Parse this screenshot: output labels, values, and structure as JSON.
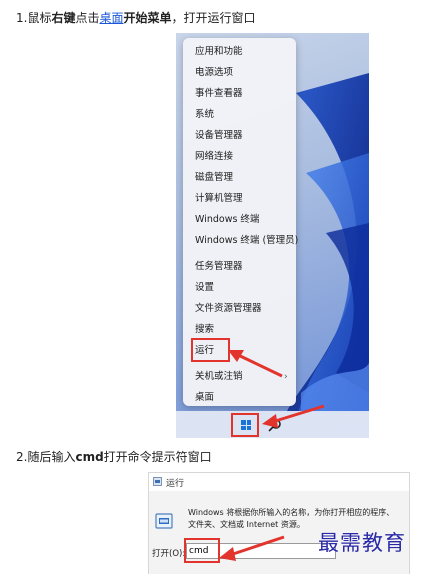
{
  "steps": {
    "step1": {
      "prefix": "1.鼠标",
      "bold1": "右键",
      "mid": "点击",
      "link": "桌面",
      "bold2": "开始菜单",
      "suffix": "，打开运行窗口"
    },
    "step2": {
      "prefix": "2.随后输入",
      "bold": "cmd",
      "suffix": "打开命令提示符窗口"
    }
  },
  "context_menu": {
    "items": [
      "应用和功能",
      "电源选项",
      "事件查看器",
      "系统",
      "设备管理器",
      "网络连接",
      "磁盘管理",
      "计算机管理",
      "Windows 终端",
      "Windows 终端 (管理员)",
      "任务管理器",
      "设置",
      "文件资源管理器",
      "搜索",
      "运行",
      "关机或注销",
      "桌面"
    ],
    "submenu_chevron": "›"
  },
  "run_dialog": {
    "title": "运行",
    "description_line1": "Windows 将根据你所输入的名称，为你打开相应的程序、",
    "description_line2": "文件夹、文档或 Internet 资源。",
    "open_label": "打开(O):",
    "input_value": "cmd"
  },
  "watermark": "最需教育",
  "colors": {
    "highlight": "#e2342c",
    "link": "#1a57d6",
    "windows_blue": "#1a74d8"
  }
}
